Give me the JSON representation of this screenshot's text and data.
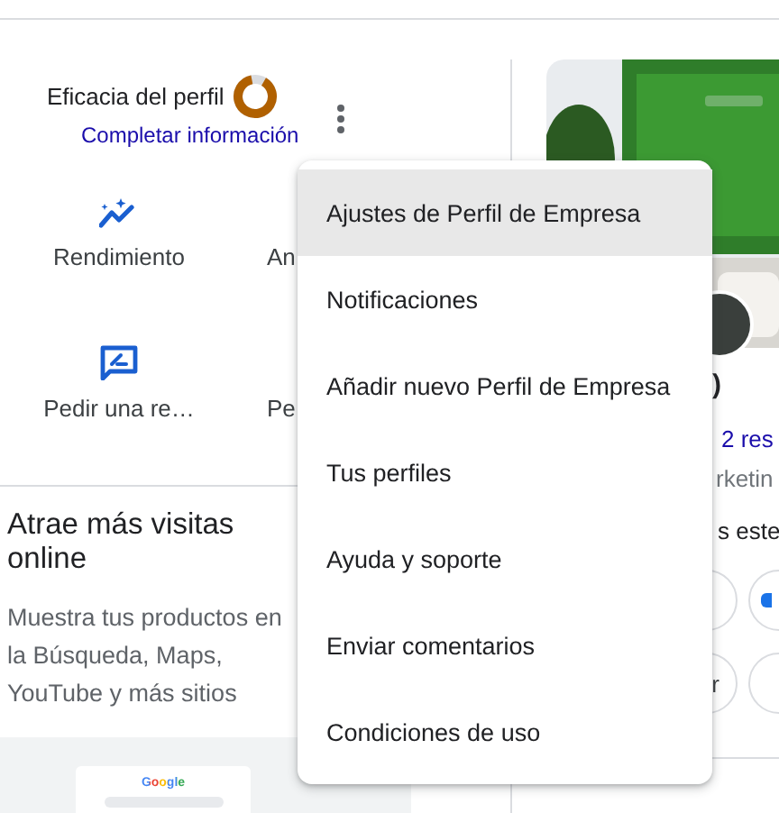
{
  "profile_strength": {
    "label": "Eficacia del perfil",
    "link": "Completar información"
  },
  "actions": [
    {
      "label": "Rendimiento",
      "kind": "performance"
    },
    {
      "label": "An"
    },
    {
      "label": "Pedir una re…",
      "kind": "review"
    },
    {
      "label": "Pe"
    }
  ],
  "promo": {
    "title": "Atrae más visitas online",
    "description": "Muestra tus productos en la Búsqueda, Maps, YouTube y más sitios",
    "preview_logo": "Google"
  },
  "business": {
    "name_fragment": ")",
    "reviews_link": "2 res",
    "category_fragment": "rketin",
    "prompt_fragment": "s este",
    "button_fragment": "r"
  },
  "menu": {
    "items": [
      {
        "label": "Ajustes de Perfil de Empresa",
        "selected": true
      },
      {
        "label": "Notificaciones",
        "selected": false
      },
      {
        "label": "Añadir nuevo Perfil de Empresa",
        "selected": false
      },
      {
        "label": "Tus perfiles",
        "selected": false
      },
      {
        "label": "Ayuda y soporte",
        "selected": false
      },
      {
        "label": "Enviar comentarios",
        "selected": false
      },
      {
        "label": "Condiciones de uso",
        "selected": false
      }
    ]
  }
}
